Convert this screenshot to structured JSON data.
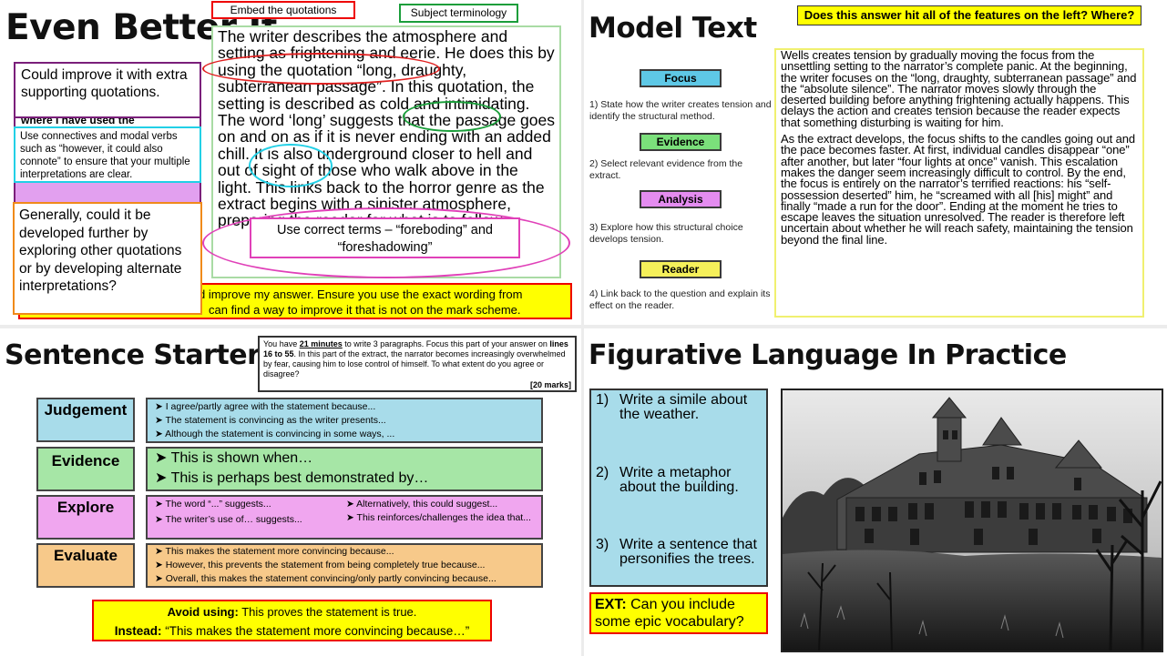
{
  "q1": {
    "title": "Even Better If",
    "tag_embed": "Embed the quotations",
    "tag_subject": "Subject terminology",
    "extract": "The writer describes the atmosphere and setting as frightening and eerie. He does this by using the quotation “long, draughty, subterranean passage”. In this quotation, the setting is described as cold and intimidating. The word ‘long’ suggests that the passage goes on and on as if it is never ending with an added chill. It is also underground closer to hell and out of sight of those who walk above in the light. This links back to the horror genre as the extract begins with a sinister atmosphere, preparing the reader for what is to follow.",
    "note_purple": "Could improve it with extra supporting quotations.",
    "note_purple_peek": "where I have used the",
    "note_cyan": "Use connectives and  modal verbs such as “however, it could also connote” to ensure that your multiple interpretations are clear.",
    "note_orange": "Generally, could it be developed further by exploring other quotations or by developing alternate interpretations?",
    "callout_correct": "Use correct terms – “foreboding” and “foreshadowing”",
    "yellow_line1": "d improve my answer. Ensure you use the exact wording from",
    "yellow_line2": "can find a way to improve it that is not on the mark scheme."
  },
  "q2": {
    "title": "Model Text",
    "question": "Does this answer hit all of the features on the left? Where?",
    "steps": [
      {
        "label": "Focus",
        "text": "1) State how the writer creates tension and identify the structural method.",
        "color": "#5ec8e6"
      },
      {
        "label": "Evidence",
        "text": "2) Select relevant evidence from the extract.",
        "color": "#7be07b"
      },
      {
        "label": "Analysis",
        "text": "3) Explore how this structural choice develops tension.",
        "color": "#e48cf0"
      },
      {
        "label": "Reader",
        "text": "4) Link back to the question and explain its effect on the reader.",
        "color": "#f5f05a"
      }
    ],
    "para1": "Wells creates tension by gradually moving the focus from the unsettling setting to the narrator’s complete panic. At the beginning, the writer focuses on the “long, draughty, subterranean passage” and the “absolute silence”. The narrator moves slowly through the deserted building before anything frightening actually happens. This delays the action and creates tension because the reader expects that something disturbing is waiting for him.",
    "para2": "As the extract develops, the focus shifts to the candles going out and the pace becomes faster. At first, individual candles disappear “one” after another, but later “four lights at once” vanish. This escalation makes the danger seem increasingly difficult to control. By the end, the focus is entirely on the narrator’s terrified reactions: his “self-possession deserted” him, he “screamed with all [his] might” and finally “made a run for the door”. Ending at the moment he tries to escape leaves the situation unresolved. The reader is therefore left uncertain about whether he will reach safety, maintaining the tension beyond the final line."
  },
  "q3": {
    "title": "Sentence Starters",
    "task_pre": "You have ",
    "task_minutes": "21 minutes",
    "task_mid": " to write 3 paragraphs. Focus this part of your answer on ",
    "task_lines": "lines 16 to 55",
    "task_post": ". In this part of the extract, the narrator becomes increasingly overwhelmed by fear, causing him to lose control of himself. To what extent do you agree or disagree?",
    "task_marks": "[20 marks]",
    "judgement": {
      "label": "Judgement",
      "items": [
        "I agree/partly agree with the statement because...",
        "The statement is convincing as the writer presents...",
        "Although the statement is convincing in some ways, ..."
      ]
    },
    "evidence": {
      "label": "Evidence",
      "items": [
        "This is shown when…",
        "This is perhaps best demonstrated by…"
      ]
    },
    "explore": {
      "label": "Explore",
      "left": [
        "The word “...” suggests...",
        "The writer’s use of… suggests..."
      ],
      "right": [
        "Alternatively, this could suggest...",
        "This reinforces/challenges the idea that..."
      ]
    },
    "evaluate": {
      "label": "Evaluate",
      "items": [
        "This makes the statement more convincing because...",
        "However, this prevents the statement from being completely true because...",
        "Overall, this makes the statement convincing/only partly convincing because..."
      ]
    },
    "avoid_label": "Avoid using:",
    "avoid_text": " This proves the statement is true.",
    "instead_label": "Instead:",
    "instead_text": " “This makes the statement more convincing because…”"
  },
  "q4": {
    "title": "Figurative Language In Practice",
    "tasks": [
      {
        "num": "1)",
        "text": "Write a simile about the weather."
      },
      {
        "num": "2)",
        "text": "Write a metaphor about the building."
      },
      {
        "num": "3)",
        "text": "Write a sentence that personifies the trees."
      }
    ],
    "ext_label": "EXT:",
    "ext_text": " Can you include some epic vocabulary?"
  }
}
